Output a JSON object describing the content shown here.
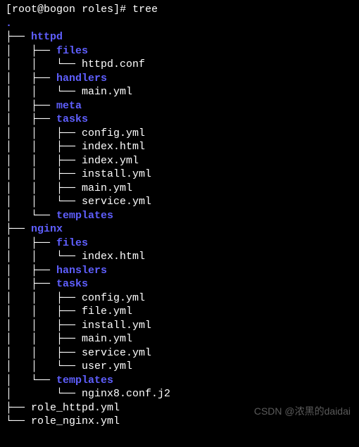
{
  "prompt": {
    "user": "root",
    "host": "bogon",
    "dir": "roles",
    "symbol": "#",
    "command": "tree"
  },
  "tree": {
    "root": ".",
    "nodes": [
      {
        "prefix": "├── ",
        "name": "httpd",
        "type": "dir"
      },
      {
        "prefix": "│   ├── ",
        "name": "files",
        "type": "dir"
      },
      {
        "prefix": "│   │   └── ",
        "name": "httpd.conf",
        "type": "file"
      },
      {
        "prefix": "│   ├── ",
        "name": "handlers",
        "type": "dir"
      },
      {
        "prefix": "│   │   └── ",
        "name": "main.yml",
        "type": "file"
      },
      {
        "prefix": "│   ├── ",
        "name": "meta",
        "type": "dir"
      },
      {
        "prefix": "│   ├── ",
        "name": "tasks",
        "type": "dir"
      },
      {
        "prefix": "│   │   ├── ",
        "name": "config.yml",
        "type": "file"
      },
      {
        "prefix": "│   │   ├── ",
        "name": "index.html",
        "type": "file"
      },
      {
        "prefix": "│   │   ├── ",
        "name": "index.yml",
        "type": "file"
      },
      {
        "prefix": "│   │   ├── ",
        "name": "install.yml",
        "type": "file"
      },
      {
        "prefix": "│   │   ├── ",
        "name": "main.yml",
        "type": "file"
      },
      {
        "prefix": "│   │   └── ",
        "name": "service.yml",
        "type": "file"
      },
      {
        "prefix": "│   └── ",
        "name": "templates",
        "type": "dir"
      },
      {
        "prefix": "├── ",
        "name": "nginx",
        "type": "dir"
      },
      {
        "prefix": "│   ├── ",
        "name": "files",
        "type": "dir"
      },
      {
        "prefix": "│   │   └── ",
        "name": "index.html",
        "type": "file"
      },
      {
        "prefix": "│   ├── ",
        "name": "hanslers",
        "type": "dir"
      },
      {
        "prefix": "│   ├── ",
        "name": "tasks",
        "type": "dir"
      },
      {
        "prefix": "│   │   ├── ",
        "name": "config.yml",
        "type": "file"
      },
      {
        "prefix": "│   │   ├── ",
        "name": "file.yml",
        "type": "file"
      },
      {
        "prefix": "│   │   ├── ",
        "name": "install.yml",
        "type": "file"
      },
      {
        "prefix": "│   │   ├── ",
        "name": "main.yml",
        "type": "file"
      },
      {
        "prefix": "│   │   ├── ",
        "name": "service.yml",
        "type": "file"
      },
      {
        "prefix": "│   │   └── ",
        "name": "user.yml",
        "type": "file"
      },
      {
        "prefix": "│   └── ",
        "name": "templates",
        "type": "dir"
      },
      {
        "prefix": "│       └── ",
        "name": "nginx8.conf.j2",
        "type": "file"
      },
      {
        "prefix": "├── ",
        "name": "role_httpd.yml",
        "type": "file"
      },
      {
        "prefix": "└── ",
        "name": "role_nginx.yml",
        "type": "file"
      }
    ]
  },
  "watermark": "CSDN @浓黑的daidai"
}
